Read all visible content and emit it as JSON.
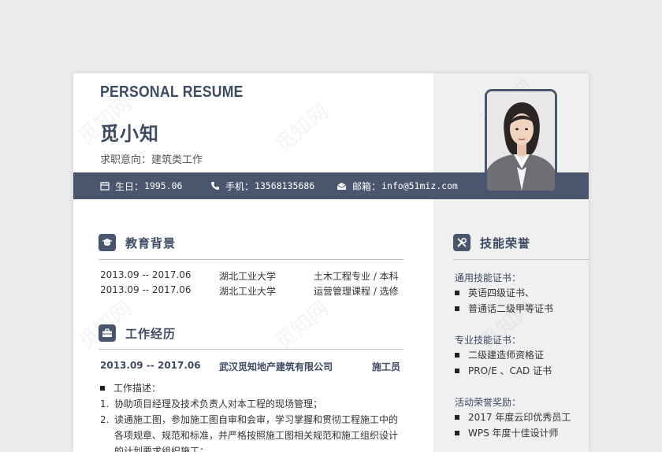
{
  "header": {
    "title_en": "PERSONAL RESUME",
    "name": "觅小知",
    "objective": "求职意向：建筑类工作"
  },
  "contact": {
    "birthday_label": "生日：",
    "birthday_value": "1995.06",
    "phone_label": "手机：",
    "phone_value": "13568135686",
    "email_label": "邮箱：",
    "email_value": "info@51miz.com"
  },
  "education": {
    "title": "教育背景",
    "rows": [
      {
        "period": "2013.09 -- 2017.06",
        "school": "湖北工业大学",
        "major": "土木工程专业 / 本科"
      },
      {
        "period": "2013.09 -- 2017.06",
        "school": "湖北工业大学",
        "major": "运营管理课程 / 选修"
      }
    ]
  },
  "work": {
    "title": "工作经历",
    "period": "2013.09 -- 2017.06",
    "company": "武汉觅知地产建筑有限公司",
    "position": "施工员",
    "desc_label": "工作描述：",
    "items": [
      {
        "num": "1.",
        "lines": [
          "协助项目经理及技术负责人对本工程的现场管理；"
        ]
      },
      {
        "num": "2.",
        "lines": [
          "读通施工图，参加施工图自审和会审，学习掌握和贯彻工程施工中的",
          "各项规章、规范和标准，并严格按照施工图相关规范和施工组织设计",
          "的计划要求组织施工；"
        ]
      }
    ]
  },
  "skills": {
    "title": "技能荣誉",
    "groups": [
      {
        "category": "通用技能证书：",
        "items": [
          "英语四级证书、",
          "普通话二级甲等证书"
        ]
      },
      {
        "category": "专业技能证书：",
        "items": [
          "二级建造师资格证",
          "PRO/E 、CAD 证书"
        ]
      },
      {
        "category": "活动荣誉奖励：",
        "items": [
          "2017 年度云印优秀员工",
          "WPS 年度十佳设计师"
        ]
      }
    ]
  },
  "watermark": "觅知网",
  "colors": {
    "accent": "#4a566e",
    "sidebar": "#f0f0f0"
  }
}
